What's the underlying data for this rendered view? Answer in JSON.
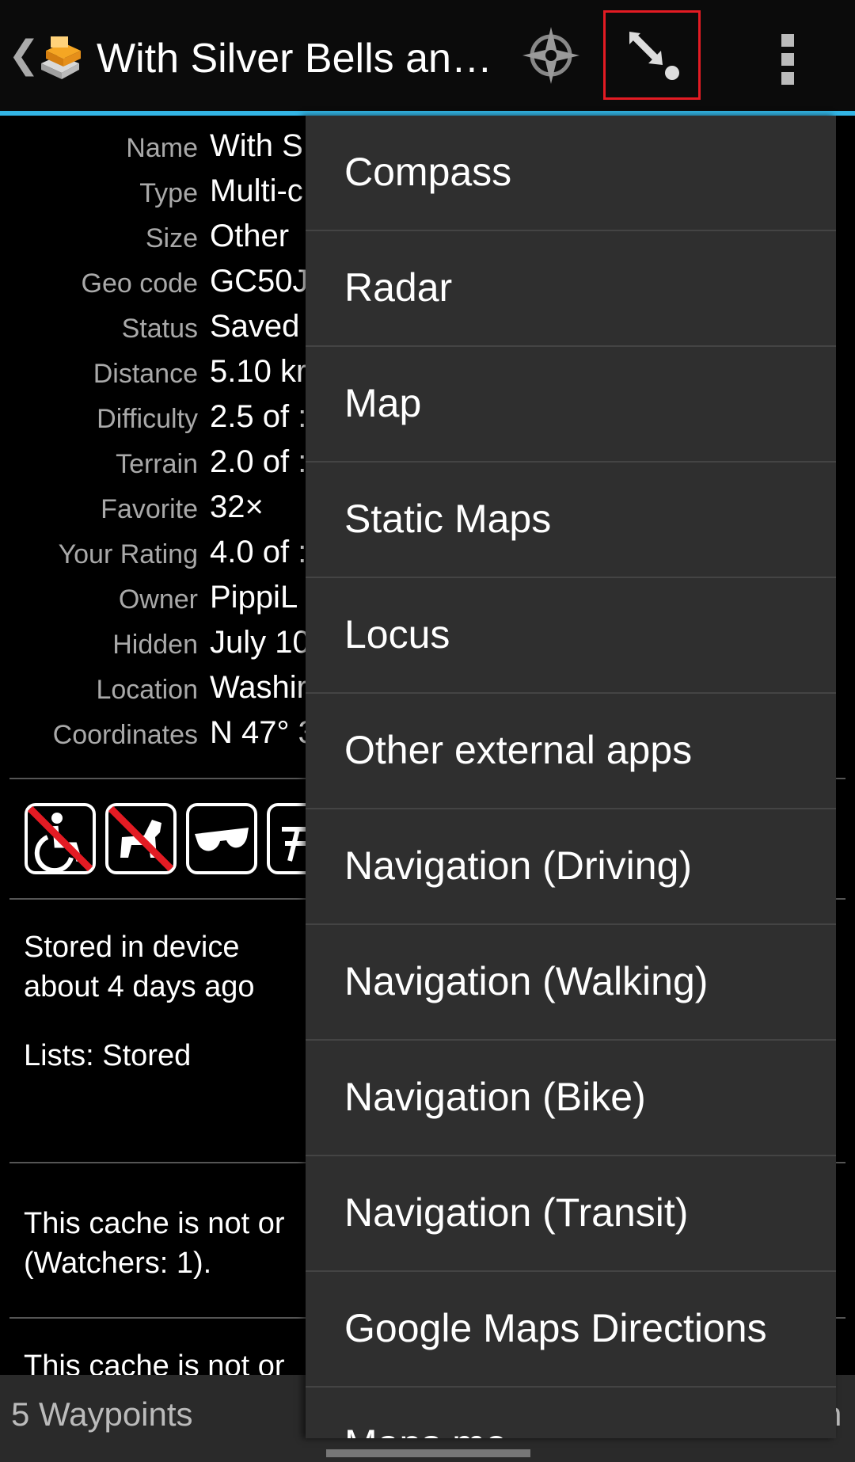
{
  "actionbar": {
    "title": "With Silver Bells an…",
    "icons": [
      "back-chevron-icon",
      "cache-app-icon",
      "compass-icon",
      "navigate-icon",
      "overflow-menu-icon"
    ],
    "accent": "#33b5e5",
    "highlight": "#e31b23"
  },
  "details": [
    {
      "label": "Name",
      "value": "With S"
    },
    {
      "label": "Type",
      "value": "Multi-c"
    },
    {
      "label": "Size",
      "value": "Other"
    },
    {
      "label": "Geo code",
      "value": "GC50J"
    },
    {
      "label": "Status",
      "value": "Saved"
    },
    {
      "label": "Distance",
      "value": "5.10 kr"
    },
    {
      "label": "Difficulty",
      "value": "2.5 of :"
    },
    {
      "label": "Terrain",
      "value": "2.0 of :"
    },
    {
      "label": "Favorite",
      "value": "32×"
    },
    {
      "label": "Your Rating",
      "value": "4.0 of :"
    },
    {
      "label": "Owner",
      "value": "PippiL"
    },
    {
      "label": "Hidden",
      "value": "July 10"
    },
    {
      "label": "Location",
      "value": "Washir"
    },
    {
      "label": "Coordinates",
      "value": "N 47° 3"
    }
  ],
  "attributes": [
    "no-wheelchair-icon",
    "no-dogs-icon",
    "sunglasses-icon",
    "partial-attribute-icon"
  ],
  "storage": {
    "line1": "Stored in device",
    "line2": "about 4 days ago",
    "lists": "Lists: Stored"
  },
  "watch": {
    "line1": "This cache is not or",
    "line2": "(Watchers: 1)."
  },
  "extra": {
    "line1": "This cache is not or"
  },
  "bottombar": {
    "label": "5 Waypoints",
    "right": "n"
  },
  "menu": {
    "items": [
      "Compass",
      "Radar",
      "Map",
      "Static Maps",
      "Locus",
      "Other external apps",
      "Navigation (Driving)",
      "Navigation (Walking)",
      "Navigation (Bike)",
      "Navigation (Transit)",
      "Google Maps Directions",
      "Maps.me"
    ]
  }
}
